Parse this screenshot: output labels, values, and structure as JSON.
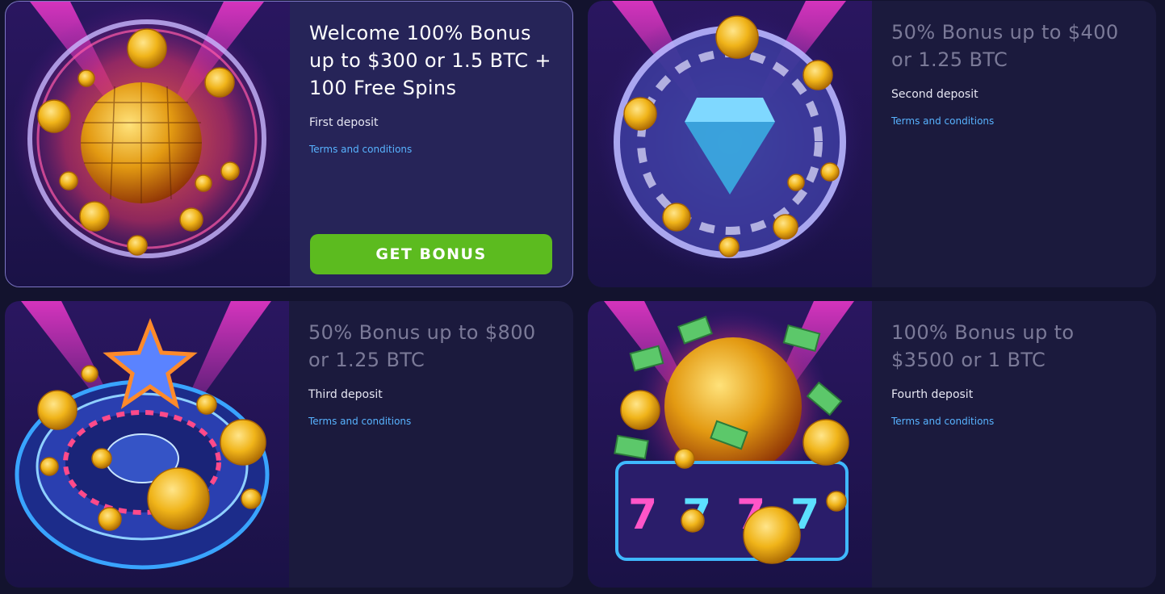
{
  "colors": {
    "page_bg": "#13132e",
    "card_bg": "#1b1a3d",
    "active_card_bg": "#262458",
    "active_card_border": "#7c76c4",
    "title_inactive": "#7b7a98",
    "link": "#58b3ff",
    "cta_bg": "#5cbb1f"
  },
  "bonuses": [
    {
      "title": "Welcome 100% Bonus up to $300 or 1.5 BTC + 100 Free Spins",
      "subtitle": "First deposit",
      "terms": "Terms and conditions",
      "cta": "GET BONUS",
      "image_icon": "disco-ball-coins-icon",
      "active": true
    },
    {
      "title": "50% Bonus up to $400 or 1.25 BTC",
      "subtitle": "Second deposit",
      "terms": "Terms and conditions",
      "image_icon": "diamond-chip-icon",
      "active": false
    },
    {
      "title": "50% Bonus up to $800 or 1.25 BTC",
      "subtitle": "Third deposit",
      "terms": "Terms and conditions",
      "image_icon": "roulette-star-icon",
      "active": false
    },
    {
      "title": "100% Bonus up to $3500 or 1 BTC",
      "subtitle": "Fourth deposit",
      "terms": "Terms and conditions",
      "image_icon": "slot-777-icon",
      "active": false
    }
  ]
}
